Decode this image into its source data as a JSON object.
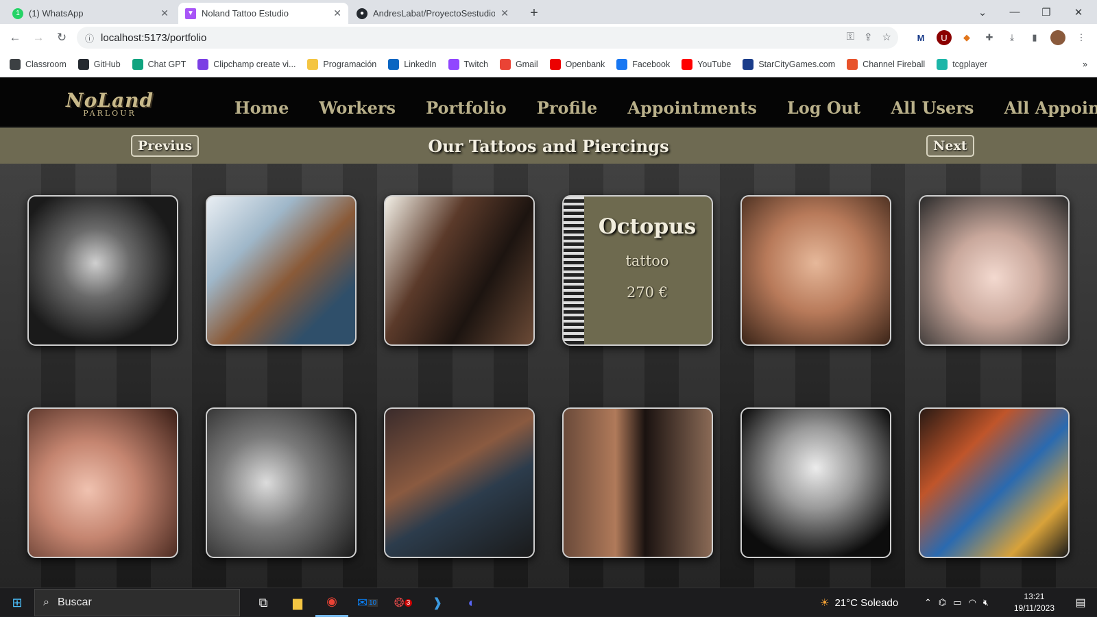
{
  "browser": {
    "tabs": [
      {
        "title": "(1) WhatsApp",
        "active": false,
        "icon": "whatsapp-icon",
        "color": "#25d366"
      },
      {
        "title": "Noland Tattoo Estudio",
        "active": true,
        "icon": "vite-icon",
        "color": "#a855f7"
      },
      {
        "title": "AndresLabat/ProyectoSestudioD",
        "active": false,
        "icon": "github-icon",
        "color": "#24292f"
      }
    ],
    "new_tab": "+",
    "url": "localhost:5173/portfolio",
    "bookmarks": [
      {
        "label": "Classroom",
        "icon": "classroom-icon",
        "color": "#3c4043"
      },
      {
        "label": "GitHub",
        "icon": "github-icon",
        "color": "#24292f"
      },
      {
        "label": "Chat GPT",
        "icon": "chatgpt-icon",
        "color": "#10a37f"
      },
      {
        "label": "Clipchamp create vi...",
        "icon": "clipchamp-icon",
        "color": "#7b3fe4"
      },
      {
        "label": "Programación",
        "icon": "folder-icon",
        "color": "#f4c542"
      },
      {
        "label": "LinkedIn",
        "icon": "linkedin-icon",
        "color": "#0a66c2"
      },
      {
        "label": "Twitch",
        "icon": "twitch-icon",
        "color": "#9146ff"
      },
      {
        "label": "Gmail",
        "icon": "gmail-icon",
        "color": "#ea4335"
      },
      {
        "label": "Openbank",
        "icon": "openbank-icon",
        "color": "#ec0000"
      },
      {
        "label": "Facebook",
        "icon": "facebook-icon",
        "color": "#1877f2"
      },
      {
        "label": "YouTube",
        "icon": "youtube-icon",
        "color": "#ff0000"
      },
      {
        "label": "StarCityGames.com",
        "icon": "starcity-icon",
        "color": "#1a3c8a"
      },
      {
        "label": "Channel Fireball",
        "icon": "channelfireball-icon",
        "color": "#e8532b"
      },
      {
        "label": "tcgplayer",
        "icon": "tcgplayer-icon",
        "color": "#1db6a8"
      }
    ]
  },
  "site": {
    "logo_line1": "NoLand",
    "logo_line2": "PARLOUR",
    "nav": [
      "Home",
      "Workers",
      "Portfolio",
      "Profile",
      "Appointments",
      "Log Out",
      "All Users",
      "All Appointments"
    ],
    "prev_label": "Previus",
    "next_label": "Next",
    "section_title": "Our Tattoos and Piercings",
    "accent": "#6e6a52",
    "nav_color": "#b9b08a",
    "flipped_card": {
      "name": "Octopus",
      "type": "tattoo",
      "price": "270 €"
    }
  },
  "gallery": [
    {
      "subject": "tiger-tattoo-image",
      "flipped": false
    },
    {
      "subject": "arm-sleeve-tattoo-image",
      "flipped": false
    },
    {
      "subject": "zipper-hand-tattoo-image",
      "flipped": false
    },
    {
      "subject": "octopus-tattoo-card",
      "flipped": true
    },
    {
      "subject": "septum-piercing-image",
      "flipped": false
    },
    {
      "subject": "ear-piercing-image",
      "flipped": false
    },
    {
      "subject": "nose-piercing-image",
      "flipped": false
    },
    {
      "subject": "helix-piercing-image",
      "flipped": false
    },
    {
      "subject": "floral-sleeve-tattoo-image",
      "flipped": false
    },
    {
      "subject": "tribal-arm-tattoo-image",
      "flipped": false
    },
    {
      "subject": "wolf-moon-tattoo-image",
      "flipped": false
    },
    {
      "subject": "phoenix-tattoo-image",
      "flipped": false
    }
  ],
  "taskbar": {
    "search_placeholder": "Buscar",
    "weather": "21°C  Soleado",
    "time": "13:21",
    "date": "19/11/2023",
    "mail_badge": "10",
    "chat_badge": "3"
  }
}
